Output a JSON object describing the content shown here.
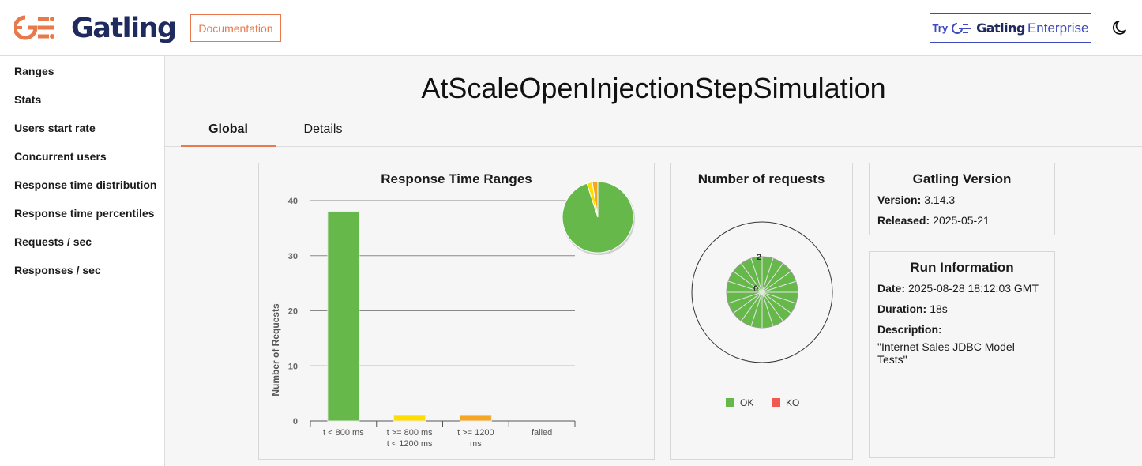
{
  "header": {
    "logo_text": "Gatling",
    "documentation_label": "Documentation",
    "enterprise": {
      "try": "Try",
      "gatling": "Gatling",
      "enterprise": "Enterprise"
    }
  },
  "sidebar": {
    "items": [
      {
        "label": "Ranges"
      },
      {
        "label": "Stats"
      },
      {
        "label": "Users start rate"
      },
      {
        "label": "Concurrent users"
      },
      {
        "label": "Response time distribution"
      },
      {
        "label": "Response time percentiles"
      },
      {
        "label": "Requests / sec"
      },
      {
        "label": "Responses / sec"
      }
    ]
  },
  "main": {
    "title": "AtScaleOpenInjectionStepSimulation",
    "tabs": [
      {
        "label": "Global"
      },
      {
        "label": "Details"
      }
    ]
  },
  "gatling_version": {
    "title": "Gatling Version",
    "version_label": "Version:",
    "version": "3.14.3",
    "released_label": "Released:",
    "released": "2025-05-21"
  },
  "run_info": {
    "title": "Run Information",
    "date_label": "Date:",
    "date": "2025-08-28 18:12:03 GMT",
    "duration_label": "Duration:",
    "duration": "18s",
    "description_label": "Description:",
    "description": "\"Internet Sales JDBC Model Tests\""
  },
  "colors": {
    "ok": "#66b84a",
    "ko": "#f15b4f",
    "yellow": "#ffdd00",
    "orange": "#f5a623",
    "accent": "#e8794a",
    "brand": "#1f2a5e"
  },
  "chart_data": [
    {
      "type": "bar",
      "title": "Response Time Ranges",
      "ylabel": "Number of Requests",
      "xlabel": "",
      "ylim": [
        0,
        40
      ],
      "yticks": [
        0,
        10,
        20,
        30,
        40
      ],
      "categories": [
        "t < 800 ms",
        "t >= 800 ms t < 1200 ms",
        "t >= 1200 ms",
        "failed"
      ],
      "tick_lines": [
        [
          "t < 800 ms"
        ],
        [
          "t >= 800 ms",
          "t < 1200 ms"
        ],
        [
          "t >= 1200",
          "ms"
        ],
        [
          "failed"
        ]
      ],
      "values": [
        38,
        1,
        1,
        0
      ],
      "bar_colors": [
        "#66b84a",
        "#ffdd00",
        "#f5a623",
        "#f15b4f"
      ],
      "grid": true,
      "inset_pie": {
        "values": [
          38,
          1,
          1,
          0
        ],
        "colors": [
          "#66b84a",
          "#ffdd00",
          "#f5a623",
          "#f15b4f"
        ]
      }
    },
    {
      "type": "pie",
      "title": "Number of requests",
      "radial_ticks": [
        "2",
        "0"
      ],
      "legend": [
        {
          "name": "OK",
          "color": "#66b84a"
        },
        {
          "name": "KO",
          "color": "#f15b4f"
        }
      ],
      "legend_position": "bottom",
      "values": [
        40,
        0
      ]
    }
  ]
}
